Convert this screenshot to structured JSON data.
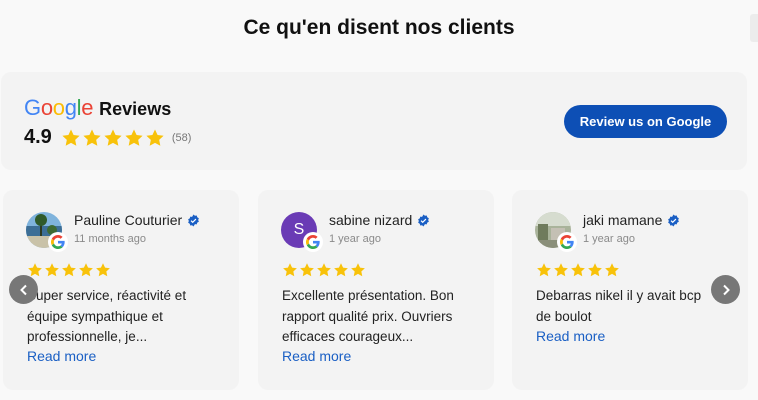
{
  "section": {
    "title": "Ce qu'en disent nos clients"
  },
  "summary": {
    "brand": "Google",
    "reviews_label": "Reviews",
    "rating": "4.9",
    "stars": 5,
    "count": "(58)",
    "button_label": "Review us on Google"
  },
  "colors": {
    "star": "#f8c20a",
    "button": "#0d4fb5",
    "verified": "#1a5fc4",
    "link": "#1a5fc4",
    "arrow": "#777777",
    "avatar_sabine": "#6a3bb5"
  },
  "reviews": [
    {
      "name": "Pauline Couturier",
      "date": "11 months ago",
      "rating": 5,
      "text_lines": [
        "Super service, réactivité et",
        "équipe sympathique et",
        "professionnelle, je..."
      ],
      "read_more": "Read more",
      "avatar": "photo-landscape"
    },
    {
      "name": "sabine nizard",
      "date": "1 year ago",
      "rating": 5,
      "text_lines": [
        "Excellente présentation. Bon",
        "rapport qualité prix. Ouvriers",
        "efficaces courageux..."
      ],
      "read_more": "Read more",
      "avatar": "initial",
      "initial": "S"
    },
    {
      "name": "jaki mamane",
      "date": "1 year ago",
      "rating": 5,
      "text_lines": [
        "Debarras nikel il y avait bcp",
        "de boulot"
      ],
      "read_more": "Read more",
      "avatar": "photo-outdoor"
    }
  ],
  "icons": {
    "prev": "chevron-left-icon",
    "next": "chevron-right-icon",
    "verified": "verified-check-icon",
    "google": "google-g-icon"
  }
}
